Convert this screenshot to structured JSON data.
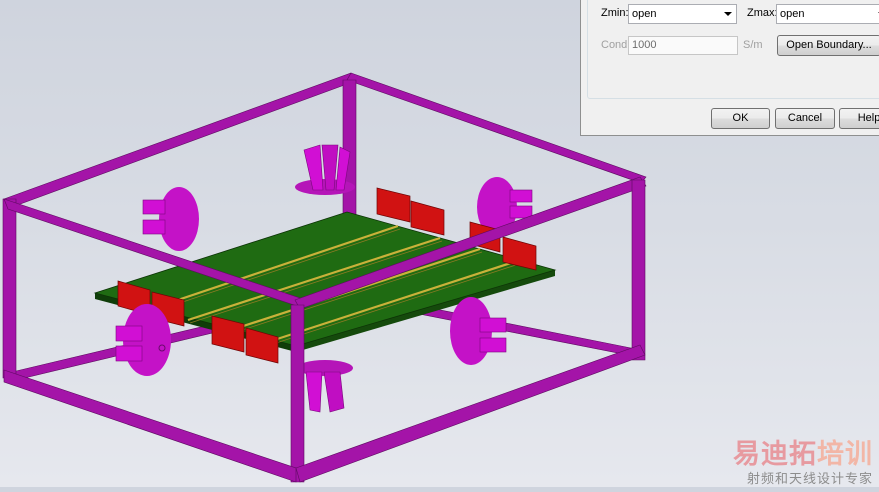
{
  "dialog": {
    "zmin_label": "Zmin:",
    "zmin_value": "open",
    "zmax_label": "Zmax:",
    "zmax_value": "open",
    "cond_label": "Cond.:",
    "cond_value": "1000",
    "cond_unit": "S/m",
    "open_boundary_label": "Open Boundary...",
    "ok_label": "OK",
    "cancel_label": "Cancel",
    "help_label": "Help"
  },
  "watermark": {
    "title_part1": "易迪拓",
    "title_part2": "培训",
    "subtitle": "射频和天线设计专家"
  },
  "colors": {
    "boundary_box": "#a414a8",
    "port": "#d10fd4",
    "board": "#1f6b12",
    "trace": "#c9b13a",
    "component": "#d11212",
    "background": "#d8dce4"
  }
}
